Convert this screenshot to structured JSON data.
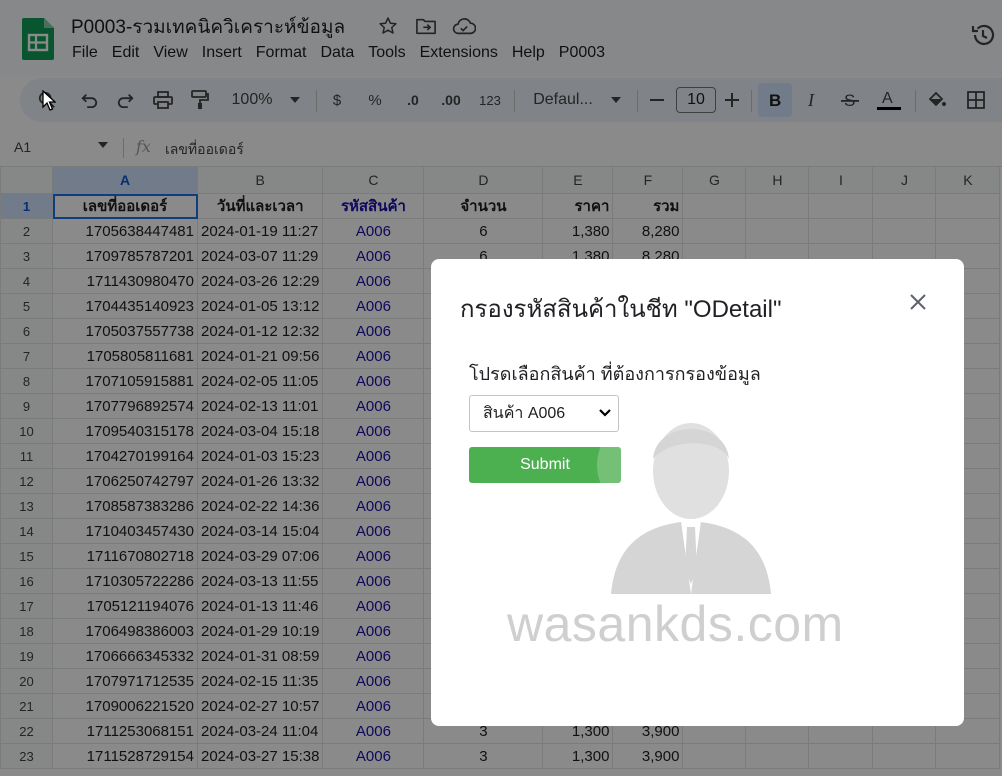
{
  "app": {
    "title": "P0003-รวมเทคนิควิเคราะห์ข้อมูล",
    "menu": [
      "File",
      "Edit",
      "View",
      "Insert",
      "Format",
      "Data",
      "Tools",
      "Extensions",
      "Help",
      "P0003"
    ]
  },
  "toolbar": {
    "zoom": "100%",
    "currency": "$",
    "percent": "%",
    "dec_decrease": ".0",
    "dec_increase": ".00",
    "number_format": "123",
    "font": "Defaul...",
    "font_size": "10"
  },
  "formula_bar": {
    "cell_ref": "A1",
    "fx": "fx",
    "content": "เลขที่ออเดอร์"
  },
  "sheet": {
    "columns": [
      "A",
      "B",
      "C",
      "D",
      "E",
      "F",
      "G",
      "H",
      "I",
      "J",
      "K"
    ],
    "header_row": [
      "เลขที่ออเดอร์",
      "วันที่และเวลา",
      "รหัสสินค้า",
      "จำนวน",
      "ราคา",
      "รวม"
    ],
    "rows": [
      {
        "n": "2",
        "a": "1705638447481",
        "b": "2024-01-19 11:27",
        "c": "A006",
        "d": "6",
        "e": "1,380",
        "f": "8,280"
      },
      {
        "n": "3",
        "a": "1709785787201",
        "b": "2024-03-07 11:29",
        "c": "A006",
        "d": "6",
        "e": "1,380",
        "f": "8,280"
      },
      {
        "n": "4",
        "a": "1711430980470",
        "b": "2024-03-26 12:29",
        "c": "A006",
        "d": "",
        "e": "",
        "f": ""
      },
      {
        "n": "5",
        "a": "1704435140923",
        "b": "2024-01-05 13:12",
        "c": "A006",
        "d": "",
        "e": "",
        "f": ""
      },
      {
        "n": "6",
        "a": "1705037557738",
        "b": "2024-01-12 12:32",
        "c": "A006",
        "d": "",
        "e": "",
        "f": ""
      },
      {
        "n": "7",
        "a": "1705805811681",
        "b": "2024-01-21 09:56",
        "c": "A006",
        "d": "",
        "e": "",
        "f": ""
      },
      {
        "n": "8",
        "a": "1707105915881",
        "b": "2024-02-05 11:05",
        "c": "A006",
        "d": "",
        "e": "",
        "f": ""
      },
      {
        "n": "9",
        "a": "1707796892574",
        "b": "2024-02-13 11:01",
        "c": "A006",
        "d": "",
        "e": "",
        "f": ""
      },
      {
        "n": "10",
        "a": "1709540315178",
        "b": "2024-03-04 15:18",
        "c": "A006",
        "d": "",
        "e": "",
        "f": ""
      },
      {
        "n": "11",
        "a": "1704270199164",
        "b": "2024-01-03 15:23",
        "c": "A006",
        "d": "",
        "e": "",
        "f": ""
      },
      {
        "n": "12",
        "a": "1706250742797",
        "b": "2024-01-26 13:32",
        "c": "A006",
        "d": "",
        "e": "",
        "f": ""
      },
      {
        "n": "13",
        "a": "1708587383286",
        "b": "2024-02-22 14:36",
        "c": "A006",
        "d": "",
        "e": "",
        "f": ""
      },
      {
        "n": "14",
        "a": "1710403457430",
        "b": "2024-03-14 15:04",
        "c": "A006",
        "d": "",
        "e": "",
        "f": ""
      },
      {
        "n": "15",
        "a": "1711670802718",
        "b": "2024-03-29 07:06",
        "c": "A006",
        "d": "",
        "e": "",
        "f": ""
      },
      {
        "n": "16",
        "a": "1710305722286",
        "b": "2024-03-13 11:55",
        "c": "A006",
        "d": "",
        "e": "",
        "f": ""
      },
      {
        "n": "17",
        "a": "1705121194076",
        "b": "2024-01-13 11:46",
        "c": "A006",
        "d": "",
        "e": "",
        "f": ""
      },
      {
        "n": "18",
        "a": "1706498386003",
        "b": "2024-01-29 10:19",
        "c": "A006",
        "d": "",
        "e": "",
        "f": ""
      },
      {
        "n": "19",
        "a": "1706666345332",
        "b": "2024-01-31 08:59",
        "c": "A006",
        "d": "",
        "e": "",
        "f": ""
      },
      {
        "n": "20",
        "a": "1707971712535",
        "b": "2024-02-15 11:35",
        "c": "A006",
        "d": "",
        "e": "",
        "f": ""
      },
      {
        "n": "21",
        "a": "1709006221520",
        "b": "2024-02-27 10:57",
        "c": "A006",
        "d": "",
        "e": "",
        "f": ""
      },
      {
        "n": "22",
        "a": "1711253068151",
        "b": "2024-03-24 11:04",
        "c": "A006",
        "d": "3",
        "e": "1,300",
        "f": "3,900"
      },
      {
        "n": "23",
        "a": "1711528729154",
        "b": "2024-03-27 15:38",
        "c": "A006",
        "d": "3",
        "e": "1,300",
        "f": "3,900"
      }
    ]
  },
  "dialog": {
    "title": "กรองรหัสสินค้าในชีท \"ODetail\"",
    "label": "โปรดเลือกสินค้า ที่ต้องการกรองข้อมูล",
    "select_value": "สินค้า A006",
    "submit": "Submit",
    "watermark": "wasankds.com"
  },
  "colors": {
    "accent": "#0b57d0",
    "product_code": "#1a0dab",
    "submit": "#4caf50",
    "sheets_green": "#0f9d58"
  }
}
